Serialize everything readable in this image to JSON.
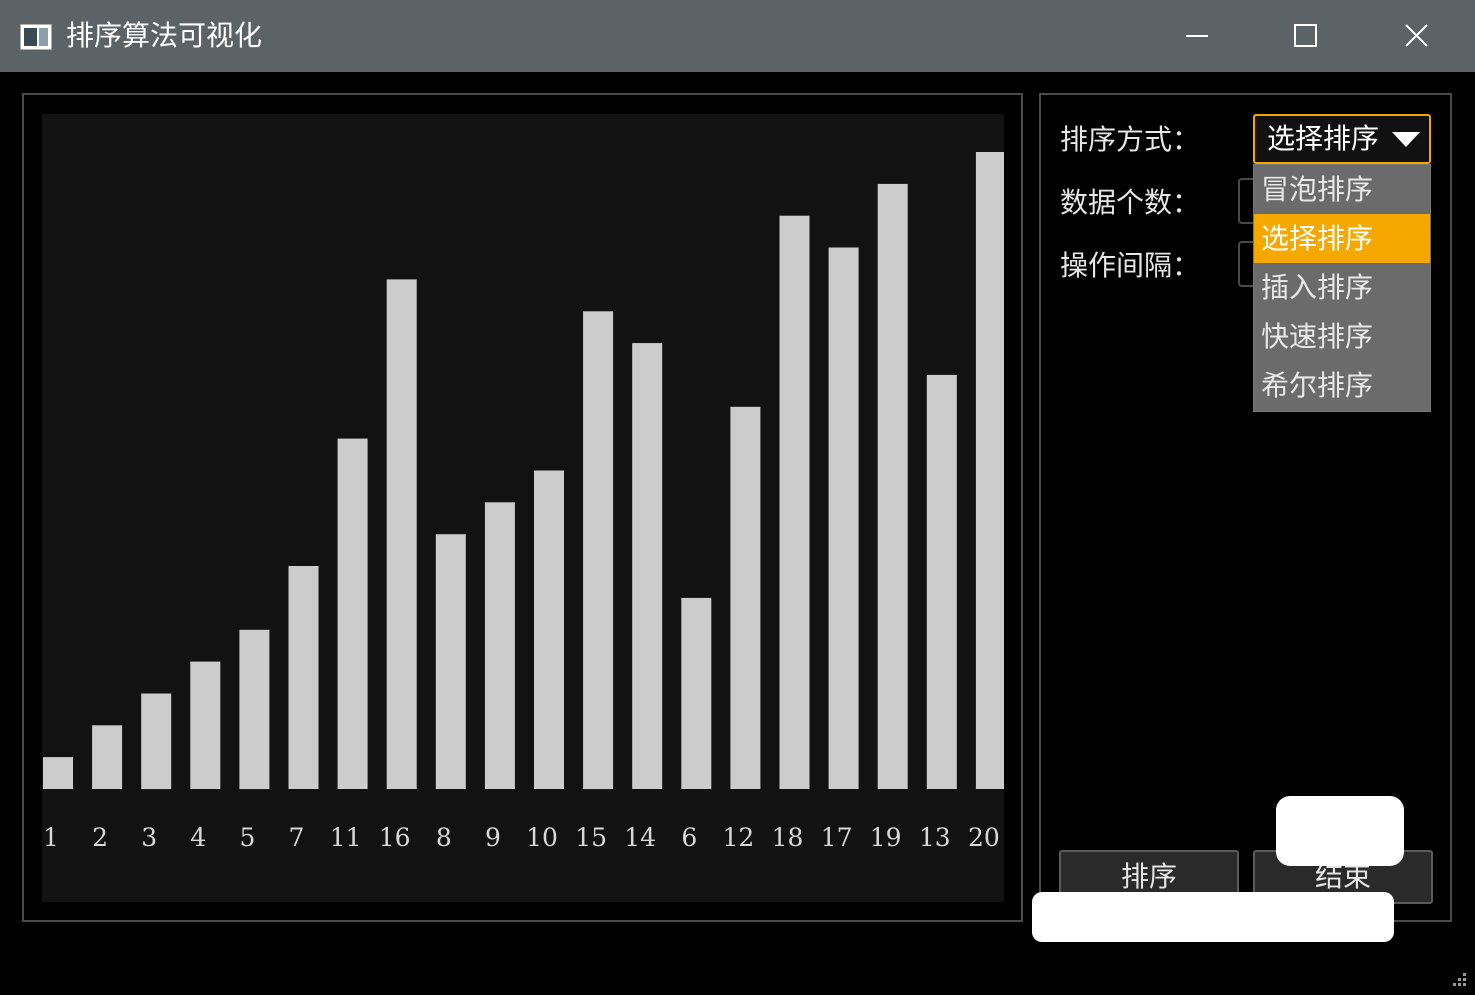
{
  "window": {
    "title": "排序算法可视化",
    "controls": [
      "minimize-icon",
      "maximize-icon",
      "close-icon"
    ]
  },
  "panel": {
    "sort_method_label": "排序方式：",
    "data_count_label": "数据个数：",
    "interval_label": "操作间隔：",
    "sort_method": {
      "selected": "选择排序",
      "options": [
        "冒泡排序",
        "选择排序",
        "插入排序",
        "快速排序",
        "希尔排序"
      ],
      "highlighted_index": 1
    },
    "sort_button": "排序",
    "stop_button": "结束"
  },
  "colors": {
    "titlebar": "#5b6367",
    "bar": "#cccccc",
    "accent": "#f5a800",
    "chart_bg": "#121212"
  },
  "chart_data": {
    "type": "bar",
    "categories": [
      "1",
      "2",
      "3",
      "4",
      "5",
      "7",
      "11",
      "16",
      "8",
      "9",
      "10",
      "15",
      "14",
      "6",
      "12",
      "18",
      "17",
      "19",
      "13",
      "20"
    ],
    "values": [
      1,
      2,
      3,
      4,
      5,
      7,
      11,
      16,
      8,
      9,
      10,
      15,
      14,
      6,
      12,
      18,
      17,
      19,
      13,
      20
    ],
    "title": "",
    "xlabel": "",
    "ylabel": "",
    "ylim": [
      0,
      20
    ],
    "grid": false
  }
}
